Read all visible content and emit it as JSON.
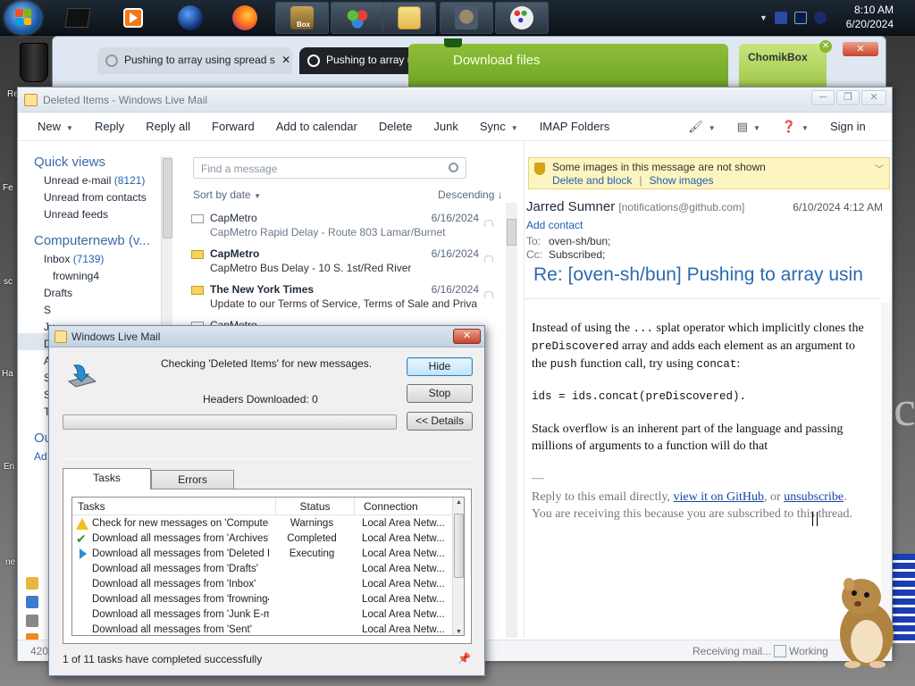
{
  "taskbar": {
    "clock_time": "8:10 AM",
    "clock_date": "6/20/2024",
    "apps": [
      {
        "icon": "black-box-icon"
      },
      {
        "icon": "media-player-icon"
      },
      {
        "icon": "globe-icon"
      },
      {
        "icon": "firefox-icon"
      },
      {
        "icon": "chomikbox-icon",
        "label": "Box"
      },
      {
        "icon": "people-icon"
      },
      {
        "icon": "folder-window-icon"
      },
      {
        "icon": "downloader-icon"
      },
      {
        "icon": "paint-icon"
      }
    ]
  },
  "browser": {
    "tab1": "Pushing to array using spread s",
    "tab2": "Pushing to array u",
    "download_bar": "Download files",
    "chomik": "ChomikBox",
    "close": "✕"
  },
  "mainwin": {
    "title": "Deleted Items - Windows Live Mail",
    "toolbar": {
      "new": "New",
      "reply": "Reply",
      "reply_all": "Reply all",
      "forward": "Forward",
      "add_calendar": "Add to calendar",
      "delete": "Delete",
      "junk": "Junk",
      "sync": "Sync",
      "imap": "IMAP Folders",
      "sign_in": "Sign in"
    },
    "nav": {
      "quick_views": "Quick views",
      "unread_email": "Unread e-mail",
      "unread_email_count": "(8121)",
      "unread_contacts": "Unread from contacts",
      "unread_feeds": "Unread feeds",
      "account": "Computernewb (v...",
      "inbox": "Inbox",
      "inbox_count": "(7139)",
      "frowning": "frowning4",
      "drafts": "Drafts",
      "partial": [
        "S",
        "Ju",
        "D",
        "A",
        "S",
        "S",
        "T"
      ],
      "outbox_partial": "Ou",
      "add_partial": "Ad"
    },
    "list": {
      "search_placeholder": "Find a message",
      "sort_by": "Sort by date",
      "sort_dir": "Descending",
      "messages": [
        {
          "from": "CapMetro",
          "date": "6/16/2024",
          "subject": "CapMetro Rapid Delay - Route 803 Lamar/Burnet",
          "unread": false
        },
        {
          "from": "CapMetro",
          "date": "6/16/2024",
          "subject": "CapMetro Bus Delay - 10 S. 1st/Red River",
          "unread": true
        },
        {
          "from": "The New York Times",
          "date": "6/16/2024",
          "subject": "Update to our Terms of Service, Terms of Sale and Priva...",
          "unread": true
        },
        {
          "from": "CapMetro",
          "date": "",
          "subject": "",
          "unread": false
        }
      ]
    },
    "reading": {
      "infobar_text": "Some images in this message are not shown",
      "delete_block": "Delete and block",
      "show_images": "Show images",
      "sender_name": "Jarred Sumner",
      "sender_email": "[notifications@github.com]",
      "date": "6/10/2024 4:12 AM",
      "add_contact": "Add contact",
      "to_label": "To:",
      "to_value": "oven-sh/bun;",
      "cc_label": "Cc:",
      "cc_value": "Subscribed;",
      "subject": "Re: [oven-sh/bun] Pushing to array usin",
      "body_p1_a": "Instead of using the ",
      "body_p1_code1": "...",
      "body_p1_b": " splat operator which implicitly clones the ",
      "body_p1_code2": "preDiscovered",
      "body_p1_c": " array and adds each element as an argument to the ",
      "body_p1_code3": "push",
      "body_p1_d": " function call, try using ",
      "body_p1_code4": "concat",
      "body_p1_e": ":",
      "body_code": "ids = ids.concat(preDiscovered).",
      "body_p2": "Stack overflow is an inherent part of the language and passing millions of arguments to a function will do that",
      "sig_dash": "—",
      "footer_a": "Reply to this email directly, ",
      "footer_link1": "view it on GitHub",
      "footer_b": ", or ",
      "footer_link2": "unsubscribe",
      "footer_c": ".",
      "footer_d": "You are receiving this because you are subscribed to this thread."
    },
    "status": {
      "left": "4205",
      "receiving": "Receiving mail...",
      "working": "Working"
    }
  },
  "dialog": {
    "title": "Windows Live Mail",
    "checking": "Checking 'Deleted Items' for new messages.",
    "headers": "Headers Downloaded: 0",
    "progress": 0,
    "hide": "Hide",
    "stop": "Stop",
    "details": "<< Details",
    "tab_tasks": "Tasks",
    "tab_errors": "Errors",
    "col_tasks": "Tasks",
    "col_status": "Status",
    "col_connection": "Connection",
    "tasks": [
      {
        "icon": "warning",
        "name": "Check for new messages on 'Computer...",
        "status": "Warnings",
        "conn": "Local Area Netw..."
      },
      {
        "icon": "ok",
        "name": "Download all messages from 'Archives'",
        "status": "Completed",
        "conn": "Local Area Netw..."
      },
      {
        "icon": "exec",
        "name": "Download all messages from 'Deleted It...",
        "status": "Executing",
        "conn": "Local Area Netw..."
      },
      {
        "icon": "",
        "name": "Download all messages from 'Drafts'",
        "status": "",
        "conn": "Local Area Netw..."
      },
      {
        "icon": "",
        "name": "Download all messages from 'Inbox'",
        "status": "",
        "conn": "Local Area Netw..."
      },
      {
        "icon": "",
        "name": "Download all messages from 'frowning4'",
        "status": "",
        "conn": "Local Area Netw..."
      },
      {
        "icon": "",
        "name": "Download all messages from 'Junk E-m...",
        "status": "",
        "conn": "Local Area Netw..."
      },
      {
        "icon": "",
        "name": "Download all messages from 'Sent'",
        "status": "",
        "conn": "Local Area Netw..."
      }
    ],
    "footer": "1 of 11 tasks have completed successfully"
  },
  "desktop": {
    "frag_re": "Re",
    "frag_fe": "Fe",
    "frag_sc": "sc",
    "frag_ha": "Ha",
    "frag_en": "En",
    "frag_ne": "ne",
    "frag_cl": "cl"
  },
  "colors": {
    "accent": "#2a6ab0",
    "link": "#2060b0",
    "info_bg": "#fdf5c0"
  }
}
